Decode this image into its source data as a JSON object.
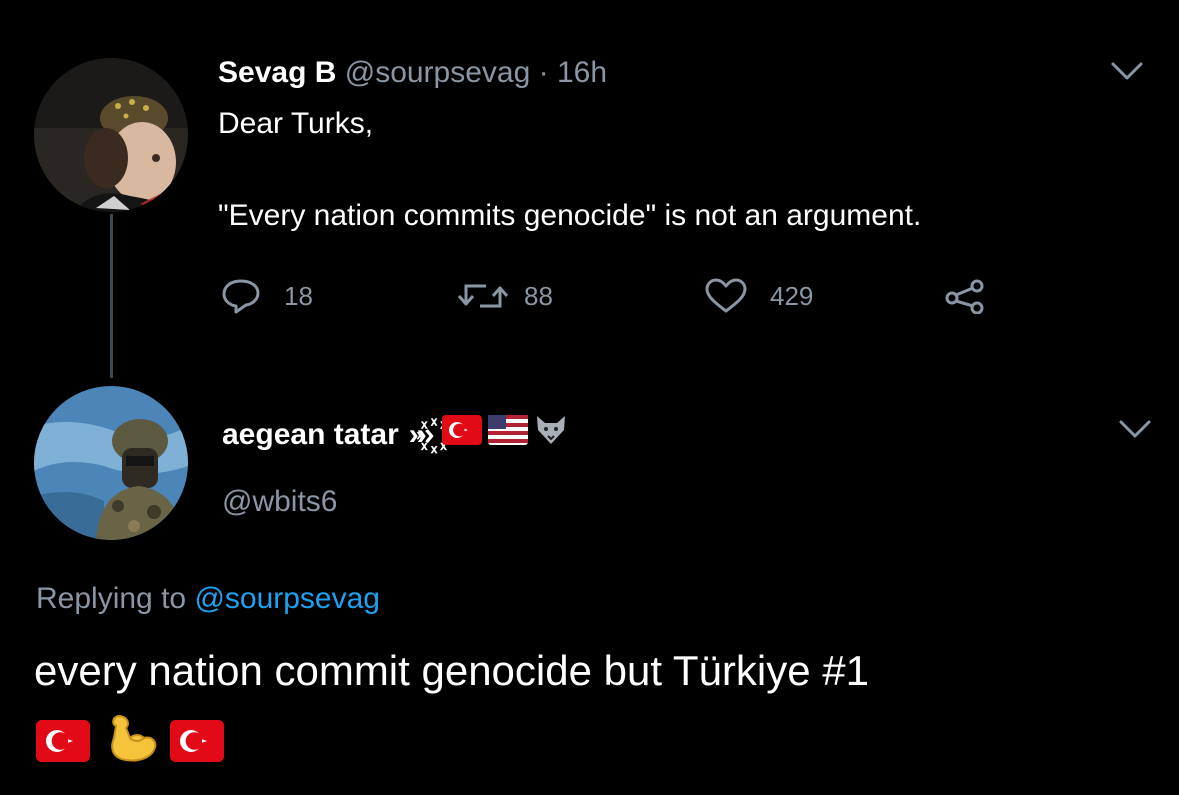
{
  "colors": {
    "background": "#000000",
    "primary_text": "#ffffff",
    "secondary_text": "#8a96a3",
    "link": "#1da1f2",
    "thread_line": "#3d4753",
    "turkish_flag_red": "#e30a17"
  },
  "tweet1": {
    "display_name": "Sevag B",
    "handle": "@sourpsevag",
    "separator": "·",
    "time": "16h",
    "line1": "Dear Turks,",
    "line2": "\"Every nation commits genocide\" is not an argument.",
    "actions": {
      "replies": {
        "icon": "reply-icon",
        "count": "18"
      },
      "retweets": {
        "icon": "retweet-icon",
        "count": "88"
      },
      "likes": {
        "icon": "heart-icon",
        "count": "429"
      },
      "share": {
        "icon": "share-icon"
      }
    },
    "menu_icon": "chevron-down-icon"
  },
  "tweet2": {
    "display_name": "aegean tatar",
    "name_decorations": "›››꙰",
    "name_emojis": [
      "turkish-flag-icon",
      "us-flag-icon",
      "wolf-icon"
    ],
    "handle": "@wbits6",
    "replying_prefix": "Replying to",
    "replying_to": "@sourpsevag",
    "body": "every nation commit genocide but Türkiye #1",
    "body_emojis": [
      "turkish-flag-icon",
      "flexed-biceps-icon",
      "turkish-flag-icon"
    ],
    "menu_icon": "chevron-down-icon"
  }
}
